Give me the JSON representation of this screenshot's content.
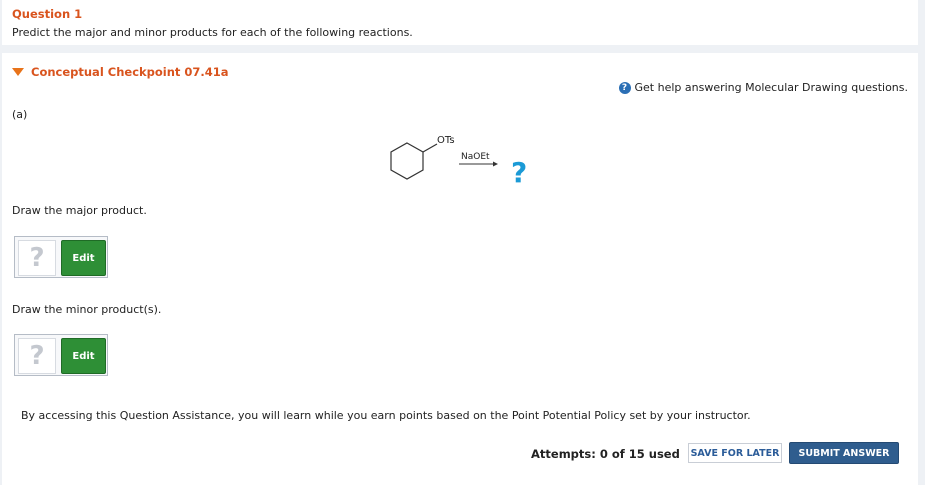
{
  "question": {
    "title": "Question 1",
    "prompt": "Predict the major and minor products for each of the following reactions."
  },
  "checkpoint": {
    "title": "Conceptual Checkpoint 07.41a",
    "help_text": "Get help answering Molecular Drawing questions.",
    "part_label": "(a)",
    "reaction": {
      "leaving_group": "OTs",
      "reagent": "NaOEt",
      "product_placeholder": "?"
    },
    "major_prompt": "Draw the major product.",
    "minor_prompt": "Draw the minor product(s).",
    "drawing_placeholder": "?",
    "edit_label": "Edit",
    "assistance_text": "By accessing this Question Assistance, you will learn while you earn points based on the Point Potential Policy set by your instructor.",
    "attempts_text": "Attempts: 0 of 15 used",
    "save_label": "SAVE FOR LATER",
    "submit_label": "SUBMIT ANSWER"
  },
  "colors": {
    "heading": "#d9541e",
    "edit_button": "#2e8f36",
    "submit_button": "#2f5d8e",
    "reaction_question_mark": "#1b9ad6"
  }
}
